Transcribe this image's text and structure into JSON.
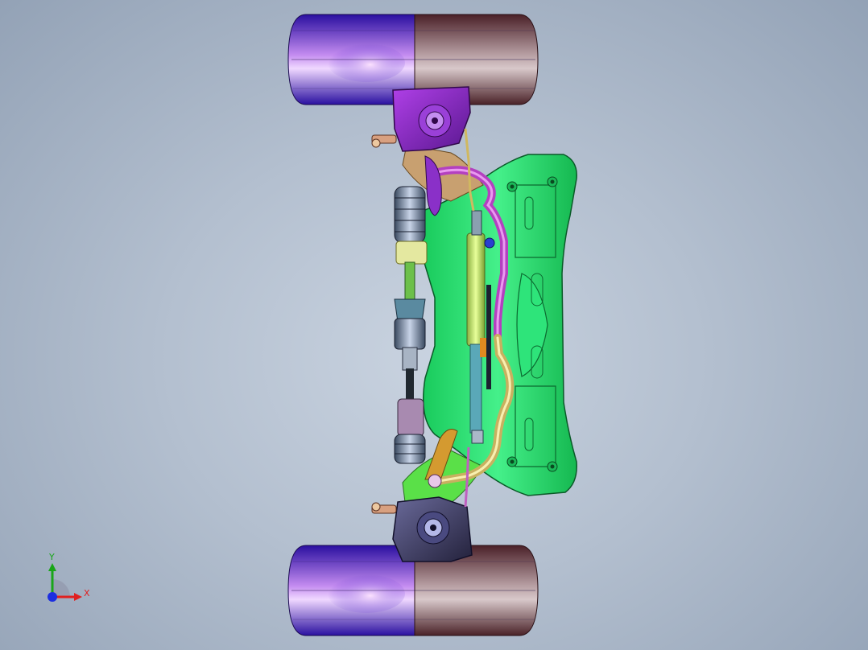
{
  "viewport": {
    "background_top": "#93a2b6",
    "background_center": "#c9d3e0"
  },
  "assembly": {
    "description_components": [
      "tire-top",
      "tire-bottom",
      "knuckle-top",
      "knuckle-bottom",
      "subframe",
      "drive-shaft",
      "steering-rack",
      "stabilizer-bar",
      "brake-line"
    ],
    "colors": {
      "tire_left": "#4a22c8",
      "tire_right": "#6e3b40",
      "knuckle_top": "#8a28c8",
      "knuckle_bottom": "#3c3a6a",
      "subframe": "#22d86a",
      "stabilizer_bar": "#c45ac0",
      "steering_rack": "#c4e06a",
      "drive_shaft": "#7a8a9a"
    }
  },
  "triad": {
    "x_label": "X",
    "y_label": "Y",
    "x_color": "#e02020",
    "y_color": "#19a519",
    "z_color": "#1c2ee0"
  }
}
